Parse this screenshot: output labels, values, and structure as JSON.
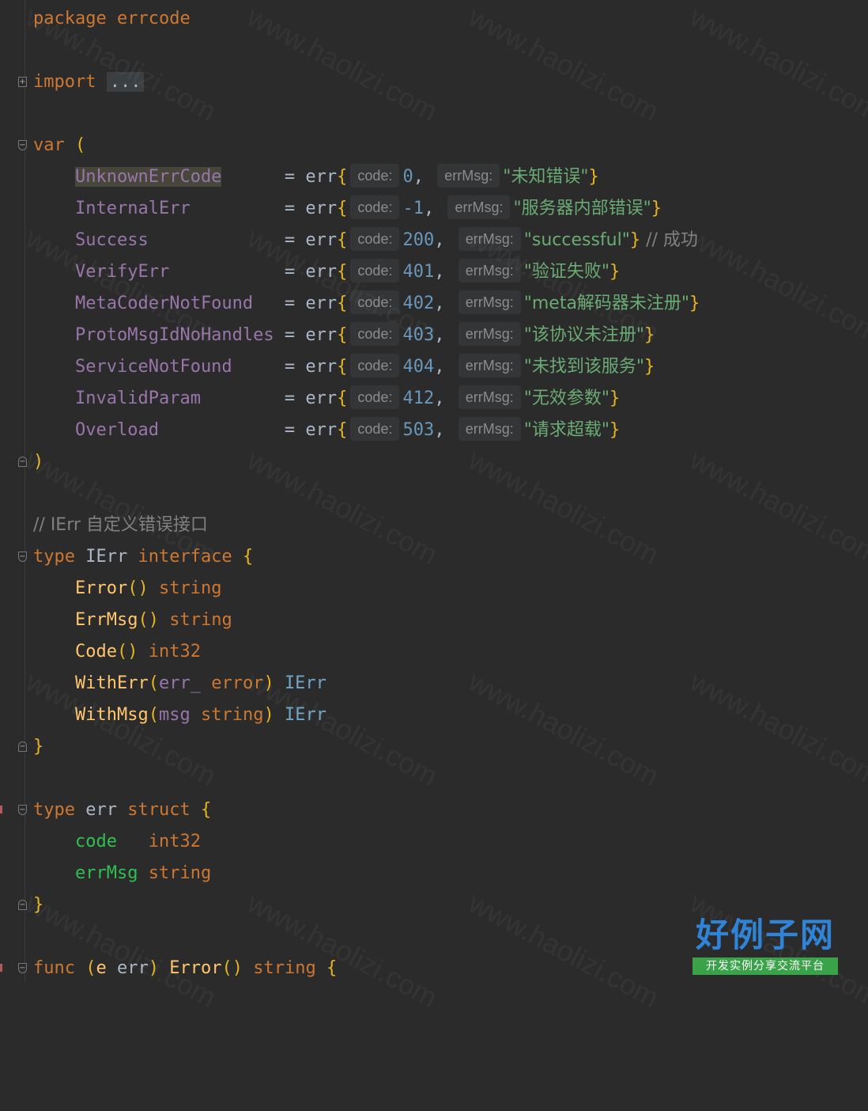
{
  "watermark": "www.haolizi.com",
  "brand": {
    "title": "好例子网",
    "subtitle": "开发实例分享交流平台"
  },
  "hints": {
    "code": "code:",
    "errMsg": "errMsg:"
  },
  "code": {
    "package_kw": "package",
    "package_name": "errcode",
    "import_kw": "import",
    "import_collapsed": "...",
    "var_kw": "var",
    "open_paren": "(",
    "close_paren": ")",
    "errors": [
      {
        "name": "UnknownErrCode",
        "code": "0",
        "msg": "\"未知错误\"",
        "comment": ""
      },
      {
        "name": "InternalErr",
        "code": "-1",
        "msg": "\"服务器内部错误\"",
        "comment": ""
      },
      {
        "name": "Success",
        "code": "200",
        "msg": "\"successful\"",
        "comment": "// 成功"
      },
      {
        "name": "VerifyErr",
        "code": "401",
        "msg": "\"验证失败\"",
        "comment": ""
      },
      {
        "name": "MetaCoderNotFound",
        "code": "402",
        "msg": "\"meta解码器未注册\"",
        "comment": ""
      },
      {
        "name": "ProtoMsgIdNoHandles",
        "code": "403",
        "msg": "\"该协议未注册\"",
        "comment": ""
      },
      {
        "name": "ServiceNotFound",
        "code": "404",
        "msg": "\"未找到该服务\"",
        "comment": ""
      },
      {
        "name": "InvalidParam",
        "code": "412",
        "msg": "\"无效参数\"",
        "comment": ""
      },
      {
        "name": "Overload",
        "code": "503",
        "msg": "\"请求超载\"",
        "comment": ""
      }
    ],
    "ierr_comment": "// IErr 自定义错误接口",
    "type_kw": "type",
    "ierr_name": "IErr",
    "interface_kw": "interface",
    "struct_kw": "struct",
    "err_name": "err",
    "func_kw": "func",
    "string_t": "string",
    "int32_t": "int32",
    "error_t": "error",
    "methods": {
      "error": "Error",
      "errmsg": "ErrMsg",
      "code": "Code",
      "witherr": "WithErr",
      "withmsg": "WithMsg"
    },
    "param_err": "err_",
    "param_msg": "msg",
    "field_code": "code",
    "field_errmsg": "errMsg",
    "recv": "e"
  }
}
